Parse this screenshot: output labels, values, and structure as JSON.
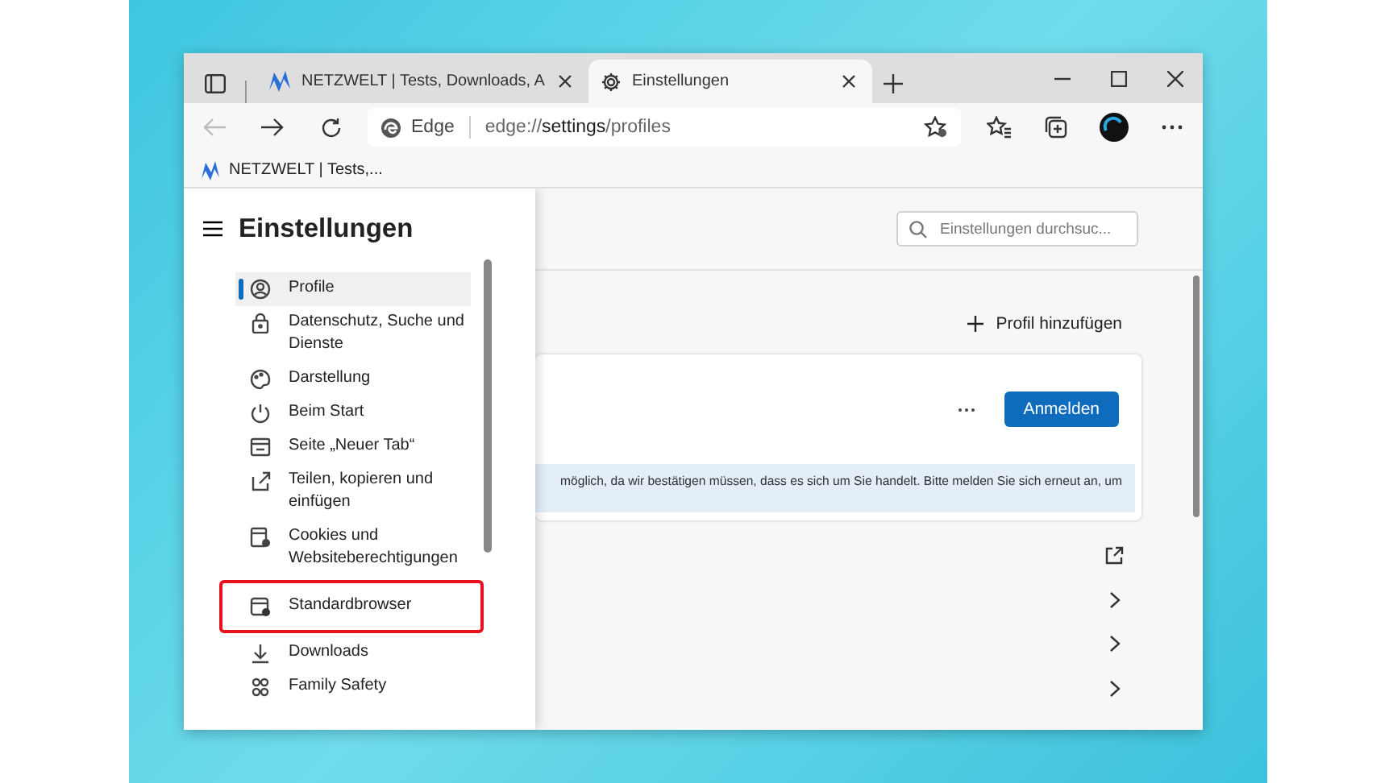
{
  "window": {
    "tabs": [
      {
        "title": "NETZWELT | Tests, Downloads, A",
        "selected": false
      },
      {
        "title": "Einstellungen",
        "selected": true
      }
    ]
  },
  "address_bar": {
    "site_label": "Edge",
    "url": "edge://**settings**/profiles"
  },
  "bookmarks": [
    {
      "label": "NETZWELT | Tests,..."
    }
  ],
  "settings": {
    "title": "Einstellungen",
    "search": {
      "placeholder": "Einstellungen durchsuc..."
    },
    "nav": [
      {
        "label": "Profile",
        "selected": true,
        "highlighted": false
      },
      {
        "label": "Datenschutz, Suche und Dienste",
        "selected": false,
        "highlighted": false
      },
      {
        "label": "Darstellung",
        "selected": false,
        "highlighted": false
      },
      {
        "label": "Beim Start",
        "selected": false,
        "highlighted": false
      },
      {
        "label": "Seite „Neuer Tab“",
        "selected": false,
        "highlighted": false
      },
      {
        "label": "Teilen, kopieren und einfügen",
        "selected": false,
        "highlighted": false
      },
      {
        "label": "Cookies und Websiteberechtigungen",
        "selected": false,
        "highlighted": false
      },
      {
        "label": "Standardbrowser",
        "selected": false,
        "highlighted": true
      },
      {
        "label": "Downloads",
        "selected": false,
        "highlighted": false
      },
      {
        "label": "Family Safety",
        "selected": false,
        "highlighted": false
      }
    ]
  },
  "main": {
    "add_profile": "Profil hinzufügen",
    "profile_card": {
      "sign_in_button": "Anmelden",
      "notice": "möglich, da wir bestätigen müssen, dass es sich um Sie handelt. Bitte melden Sie sich erneut an, um"
    },
    "rows": [
      {
        "kind": "external"
      },
      {
        "kind": "chevron"
      },
      {
        "kind": "chevron"
      },
      {
        "kind": "chevron"
      }
    ]
  }
}
